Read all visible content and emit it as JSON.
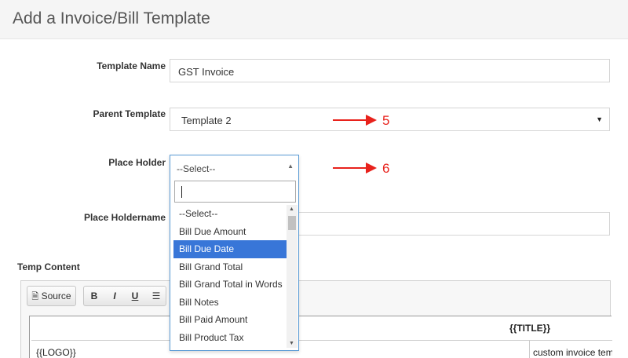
{
  "page": {
    "title": "Add a Invoice/Bill Template"
  },
  "form": {
    "template_name": {
      "label": "Template Name",
      "value": "GST Invoice"
    },
    "parent_template": {
      "label": "Parent Template",
      "value": "Template 2"
    },
    "place_holder": {
      "label": "Place Holder",
      "value": "--Select--"
    },
    "place_holdername": {
      "label": "Place Holdername",
      "value": ""
    },
    "temp_content": {
      "label": "Temp Content"
    }
  },
  "annotations": {
    "arrow_5": "5",
    "arrow_6": "6"
  },
  "dropdown": {
    "options": [
      {
        "label": "--Select--"
      },
      {
        "label": "Bill Due Amount"
      },
      {
        "label": "Bill Due Date"
      },
      {
        "label": "Bill Grand Total"
      },
      {
        "label": "Bill Grand Total in Words"
      },
      {
        "label": "Bill Notes"
      },
      {
        "label": "Bill Paid Amount"
      },
      {
        "label": "Bill Product Tax"
      }
    ],
    "highlighted": "Bill Due Date"
  },
  "editor": {
    "toolbar": {
      "source": "Source",
      "bold": "B",
      "italic": "I",
      "underline": "U"
    },
    "content": {
      "title_placeholder": "{{TITLE}}",
      "logo_placeholder": "{{LOGO}}",
      "custom_text": "custom invoice tem"
    }
  },
  "colors": {
    "annotation": "#e8221c",
    "highlight": "#3876d8",
    "focus_border": "#5b9bd5"
  },
  "icons": {
    "select_caret": "caret-down-icon",
    "dropdown_caret": "caret-up-icon",
    "source": "document-icon",
    "align": "align-left-icon"
  }
}
